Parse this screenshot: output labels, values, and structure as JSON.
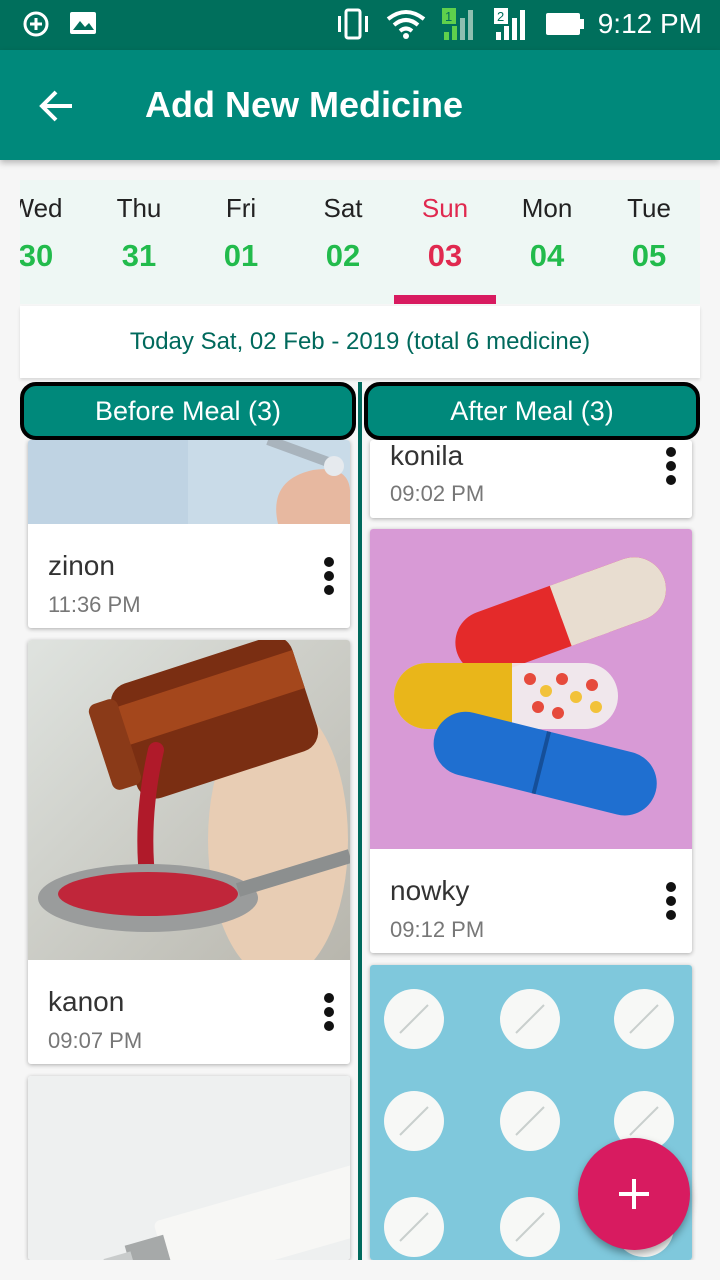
{
  "status_bar": {
    "time": "9:12 PM"
  },
  "app_bar": {
    "title": "Add New Medicine"
  },
  "calendar": {
    "days": [
      {
        "name": "Wed",
        "num": "30"
      },
      {
        "name": "Thu",
        "num": "31"
      },
      {
        "name": "Fri",
        "num": "01"
      },
      {
        "name": "Sat",
        "num": "02"
      },
      {
        "name": "Sun",
        "num": "03"
      },
      {
        "name": "Mon",
        "num": "04"
      },
      {
        "name": "Tue",
        "num": "05"
      }
    ],
    "selected_index": 4
  },
  "summary": "Today Sat, 02 Feb - 2019 (total 6 medicine)",
  "columns": {
    "before": {
      "label": "Before Meal (3)"
    },
    "after": {
      "label": "After Meal (3)"
    }
  },
  "before_meal": [
    {
      "name": "zinon",
      "time": "11:36 PM"
    },
    {
      "name": "kanon",
      "time": "09:07 PM"
    }
  ],
  "after_meal": [
    {
      "name": "konila",
      "time": "09:02 PM"
    },
    {
      "name": "nowky",
      "time": "09:12 PM"
    }
  ],
  "colors": {
    "primary": "#00897b",
    "primary_dark": "#006f5c",
    "accent": "#d81b60",
    "date_green": "#22bb4c",
    "selected_red": "#e0294f"
  },
  "icons": [
    "add-circle-icon",
    "image-icon",
    "vibrate-icon",
    "wifi-icon",
    "signal-icon",
    "battery-icon",
    "back-arrow-icon",
    "more-vert-icon",
    "plus-icon"
  ]
}
